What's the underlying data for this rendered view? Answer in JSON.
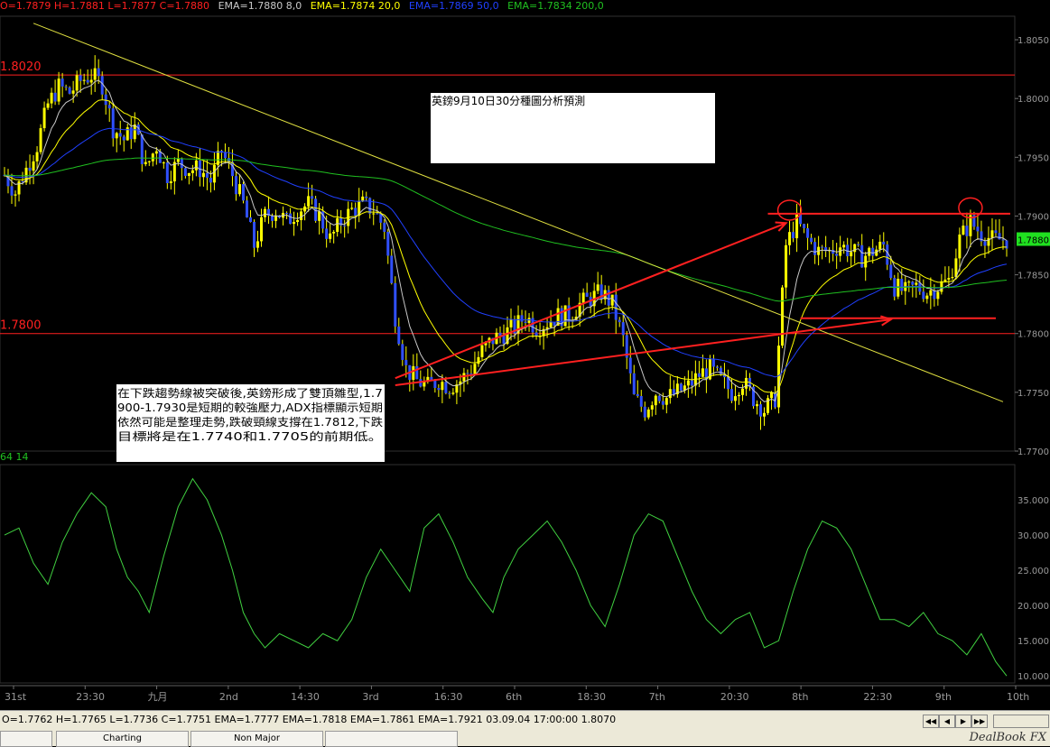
{
  "header": {
    "ohlc": "O=1.7879 H=1.7881 L=1.7877 C=1.7880",
    "ema8": "EMA=1.7880  8,0",
    "ema20": "EMA=1.7874  20,0",
    "ema50": "EMA=1.7869  50,0",
    "ema200": "EMA=1.7834  200,0",
    "ohlc_color": "#ff2020",
    "ema8_color": "#c8c8c8",
    "ema20_color": "#ffff00",
    "ema50_color": "#2040ff",
    "ema200_color": "#20c020"
  },
  "chart_data": [
    {
      "type": "candlestick",
      "instrument": "GBP/USD 30 min",
      "ylim": [
        1.77,
        1.807
      ],
      "price_axis_ticks": [
        "1.8050",
        "1.8000",
        "1.7950",
        "1.7900",
        "1.7850",
        "1.7800",
        "1.7750",
        "1.7700"
      ],
      "current_price_label": "1.7880",
      "time_axis_labels": [
        "31st",
        "23:30",
        "九月",
        "2nd",
        "14:30",
        "3rd",
        "16:30",
        "6th",
        "18:30",
        "7th",
        "20:30",
        "8th",
        "22:30",
        "9th",
        "10th"
      ],
      "levels": [
        {
          "label": "1.8020",
          "value": 1.802,
          "color": "#ff2020"
        },
        {
          "label": "1.7800",
          "value": 1.78,
          "color": "#ff2020"
        }
      ],
      "title_box": "英鎊9月10日30分種圖分析預測",
      "annotation": "在下跌趨勢線被突破後,英鎊形成了雙頂雛型,1.7900-1.7930是短期的較強壓力,ADX指標顯示短期依然可能是整理走勢,跌破頸線支撐在1.7812,下跌目標將是在1.7740和1.7705的前期低。",
      "close_path": [
        [
          0,
          1.7935
        ],
        [
          3,
          1.792
        ],
        [
          6,
          1.794
        ],
        [
          9,
          1.796
        ],
        [
          12,
          1.7995
        ],
        [
          15,
          1.801
        ],
        [
          18,
          1.8005
        ],
        [
          21,
          1.8015
        ],
        [
          24,
          1.802
        ],
        [
          27,
          1.8012
        ],
        [
          30,
          1.7975
        ],
        [
          33,
          1.7965
        ],
        [
          36,
          1.7975
        ],
        [
          39,
          1.794
        ],
        [
          42,
          1.796
        ],
        [
          45,
          1.7935
        ],
        [
          48,
          1.7945
        ],
        [
          51,
          1.794
        ],
        [
          54,
          1.794
        ],
        [
          57,
          1.793
        ],
        [
          60,
          1.7955
        ],
        [
          63,
          1.7935
        ],
        [
          66,
          1.791
        ],
        [
          69,
          1.7875
        ],
        [
          72,
          1.79
        ],
        [
          75,
          1.7905
        ],
        [
          78,
          1.7895
        ],
        [
          81,
          1.7905
        ],
        [
          84,
          1.791
        ],
        [
          87,
          1.79
        ],
        [
          90,
          1.788
        ],
        [
          93,
          1.7895
        ],
        [
          96,
          1.7905
        ],
        [
          99,
          1.791
        ],
        [
          102,
          1.7905
        ],
        [
          105,
          1.789
        ],
        [
          108,
          1.7815
        ],
        [
          111,
          1.777
        ],
        [
          114,
          1.776
        ],
        [
          117,
          1.7755
        ],
        [
          120,
          1.776
        ],
        [
          123,
          1.7755
        ],
        [
          126,
          1.776
        ],
        [
          129,
          1.777
        ],
        [
          132,
          1.7785
        ],
        [
          135,
          1.7795
        ],
        [
          138,
          1.78
        ],
        [
          141,
          1.7805
        ],
        [
          144,
          1.7815
        ],
        [
          147,
          1.7805
        ],
        [
          150,
          1.781
        ],
        [
          153,
          1.7815
        ],
        [
          156,
          1.7815
        ],
        [
          159,
          1.7825
        ],
        [
          162,
          1.783
        ],
        [
          165,
          1.7835
        ],
        [
          168,
          1.7825
        ],
        [
          171,
          1.7795
        ],
        [
          174,
          1.7745
        ],
        [
          177,
          1.7735
        ],
        [
          180,
          1.775
        ],
        [
          183,
          1.7745
        ],
        [
          186,
          1.775
        ],
        [
          189,
          1.7755
        ],
        [
          192,
          1.7765
        ],
        [
          195,
          1.777
        ],
        [
          198,
          1.776
        ],
        [
          201,
          1.775
        ],
        [
          204,
          1.776
        ],
        [
          207,
          1.7745
        ],
        [
          210,
          1.7735
        ],
        [
          213,
          1.7745
        ],
        [
          216,
          1.7875
        ],
        [
          219,
          1.7895
        ],
        [
          222,
          1.788
        ],
        [
          225,
          1.787
        ],
        [
          228,
          1.787
        ],
        [
          231,
          1.7875
        ],
        [
          234,
          1.787
        ],
        [
          237,
          1.7865
        ],
        [
          240,
          1.787
        ],
        [
          243,
          1.7875
        ],
        [
          246,
          1.784
        ],
        [
          249,
          1.7835
        ],
        [
          252,
          1.784
        ],
        [
          255,
          1.7835
        ],
        [
          258,
          1.784
        ],
        [
          261,
          1.7845
        ],
        [
          264,
          1.788
        ],
        [
          267,
          1.7895
        ],
        [
          270,
          1.7885
        ],
        [
          273,
          1.788
        ]
      ]
    },
    {
      "type": "line",
      "indicator": "ADX",
      "header_values": [
        "64",
        "14"
      ],
      "ylim": [
        9.0,
        40.0
      ],
      "y_ticks": [
        "35.000",
        "30.000",
        "25.000",
        "20.000",
        "15.000",
        "10.000"
      ],
      "series": [
        {
          "values": [
            [
              0,
              30
            ],
            [
              4,
              31
            ],
            [
              8,
              26
            ],
            [
              12,
              23
            ],
            [
              16,
              29
            ],
            [
              20,
              33
            ],
            [
              24,
              36
            ],
            [
              28,
              34
            ],
            [
              31,
              28
            ],
            [
              34,
              24
            ],
            [
              37,
              22
            ],
            [
              40,
              19
            ],
            [
              44,
              27
            ],
            [
              48,
              34
            ],
            [
              52,
              38
            ],
            [
              56,
              35
            ],
            [
              60,
              30
            ],
            [
              63,
              25
            ],
            [
              66,
              19
            ],
            [
              69,
              16
            ],
            [
              72,
              14
            ],
            [
              76,
              16
            ],
            [
              80,
              15
            ],
            [
              84,
              14
            ],
            [
              88,
              16
            ],
            [
              92,
              15
            ],
            [
              96,
              18
            ],
            [
              100,
              24
            ],
            [
              104,
              28
            ],
            [
              108,
              25
            ],
            [
              112,
              22
            ],
            [
              116,
              31
            ],
            [
              120,
              33
            ],
            [
              124,
              29
            ],
            [
              128,
              24
            ],
            [
              132,
              21
            ],
            [
              135,
              19
            ],
            [
              138,
              24
            ],
            [
              142,
              28
            ],
            [
              146,
              30
            ],
            [
              150,
              32
            ],
            [
              154,
              29
            ],
            [
              158,
              25
            ],
            [
              162,
              20
            ],
            [
              166,
              17
            ],
            [
              170,
              23
            ],
            [
              174,
              30
            ],
            [
              178,
              33
            ],
            [
              182,
              32
            ],
            [
              186,
              27
            ],
            [
              190,
              22
            ],
            [
              194,
              18
            ],
            [
              198,
              16
            ],
            [
              202,
              18
            ],
            [
              206,
              19
            ],
            [
              210,
              14
            ],
            [
              214,
              15
            ],
            [
              218,
              22
            ],
            [
              222,
              28
            ],
            [
              226,
              32
            ],
            [
              230,
              31
            ],
            [
              234,
              28
            ],
            [
              238,
              23
            ],
            [
              242,
              18
            ],
            [
              246,
              18
            ],
            [
              250,
              17
            ],
            [
              254,
              19
            ],
            [
              258,
              16
            ],
            [
              262,
              15
            ],
            [
              266,
              13
            ],
            [
              270,
              16
            ],
            [
              274,
              12
            ],
            [
              277,
              10
            ]
          ]
        }
      ]
    }
  ],
  "status": {
    "text": "O=1.7762 H=1.7765 L=1.7736 C=1.7751  EMA=1.7777 EMA=1.7818 EMA=1.7861 EMA=1.7921  03.09.04 17:00:00 1.8070"
  },
  "tabs": [
    {
      "label": ""
    },
    {
      "label": "Charting"
    },
    {
      "label": "Non Major"
    },
    {
      "label": ""
    }
  ],
  "brand": "DealBook FX"
}
